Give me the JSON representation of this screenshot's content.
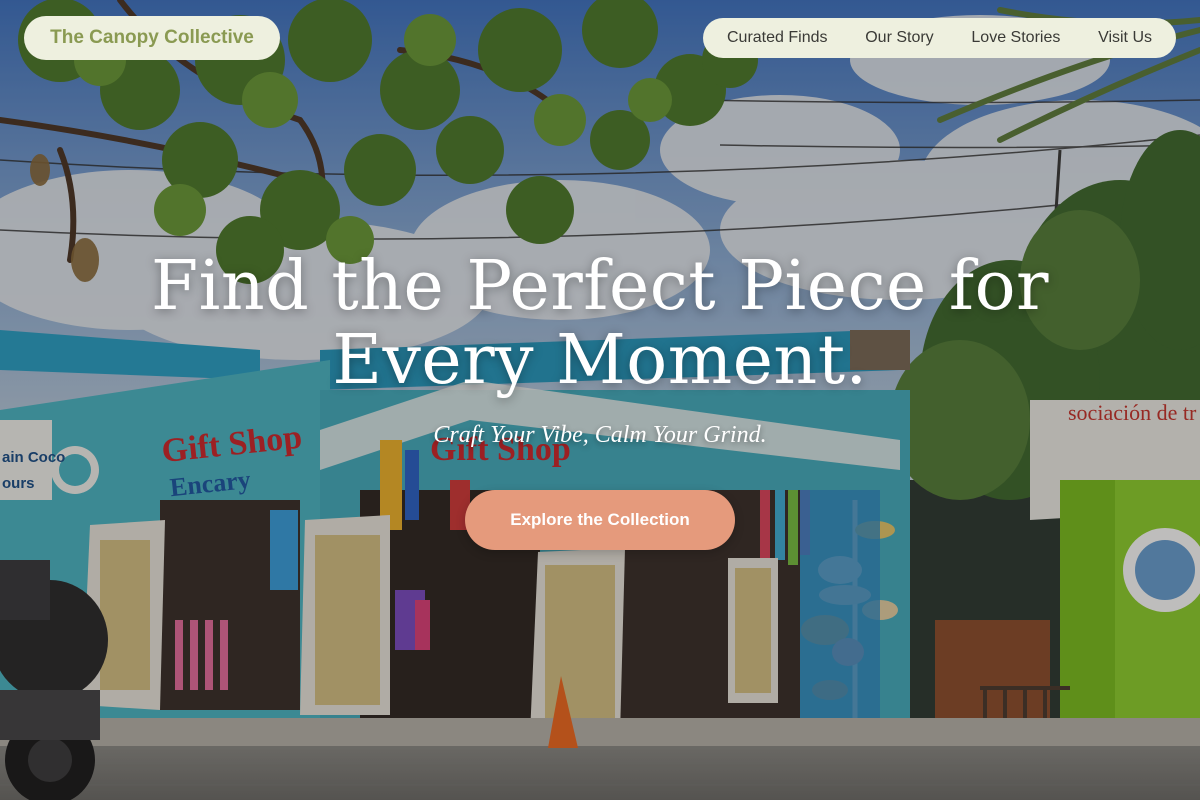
{
  "brand": {
    "name": "The Canopy Collective"
  },
  "nav": {
    "items": [
      {
        "label": "Curated Finds"
      },
      {
        "label": "Our Story"
      },
      {
        "label": "Love Stories"
      },
      {
        "label": "Visit Us"
      }
    ]
  },
  "hero": {
    "headline_line1": "Find the Perfect Piece for",
    "headline_line2": "Every Moment.",
    "tagline": "Craft Your Vibe, Calm Your Grind.",
    "cta_label": "Explore the Collection"
  },
  "background_scene": {
    "shop_sign_left": "Gift Shop",
    "shop_sign_left_sub": "Encary",
    "shop_sign_center": "Gift Shop",
    "tour_sign_line1": "ain Coco",
    "tour_sign_line2": "ours",
    "kiosk_sign": "sociación de tr"
  },
  "colors": {
    "pill_bg": "#eef0df",
    "brand_text": "#8a9a52",
    "cta_bg": "#e59a7c",
    "headline_text": "#ffffff"
  }
}
